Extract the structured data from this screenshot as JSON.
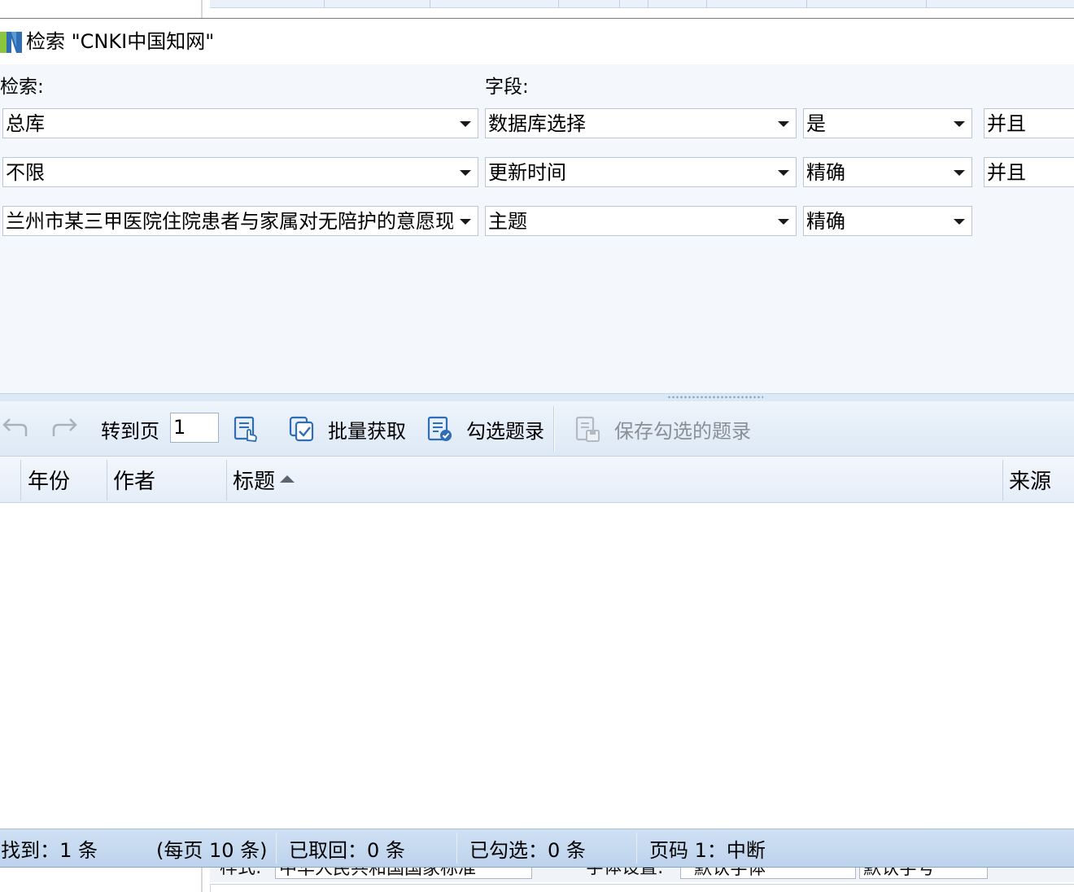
{
  "window": {
    "title": "检索 \"CNKI中国知网\"",
    "icon": "cnki-app-icon"
  },
  "search": {
    "search_label": "检索:",
    "field_label": "字段:",
    "rows": [
      {
        "value": "总库",
        "field": "数据库选择",
        "match": "是",
        "logic": "并且"
      },
      {
        "value": "不限",
        "field": "更新时间",
        "match": "精确",
        "logic": "并且"
      },
      {
        "value": "兰州市某三甲医院住院患者与家属对无陪护的意愿现",
        "field": "主题",
        "match": "精确"
      }
    ]
  },
  "toolbar": {
    "back_icon": "undo-arrow-icon",
    "forward_icon": "redo-arrow-icon",
    "goto_label": "转到页",
    "page_value": "1",
    "batch_label": "批量获取",
    "select_label": "勾选题录",
    "save_label": "保存勾选的题录"
  },
  "grid": {
    "columns": [
      "年份",
      "作者",
      "标题",
      "来源"
    ],
    "sort_column": "标题",
    "sort_direction": "ascending"
  },
  "status": {
    "found": "找到：1 条",
    "per_page": "(每页 10 条)",
    "retrieved": "已取回：0 条",
    "checked": "已勾选：0 条",
    "page_status": "页码 1：中断"
  },
  "background_app": {
    "style_label": "样式:",
    "style_value": "中华人民共和国国家标准",
    "font_label": "字体设置:",
    "font_value": "默认字体",
    "size_value": "默认字号"
  },
  "colors": {
    "accent": "#2f6db5",
    "toolbar_bg": "#e4edf8",
    "status_bg": "#c6d9ef",
    "disabled_text": "#8a8f96"
  }
}
